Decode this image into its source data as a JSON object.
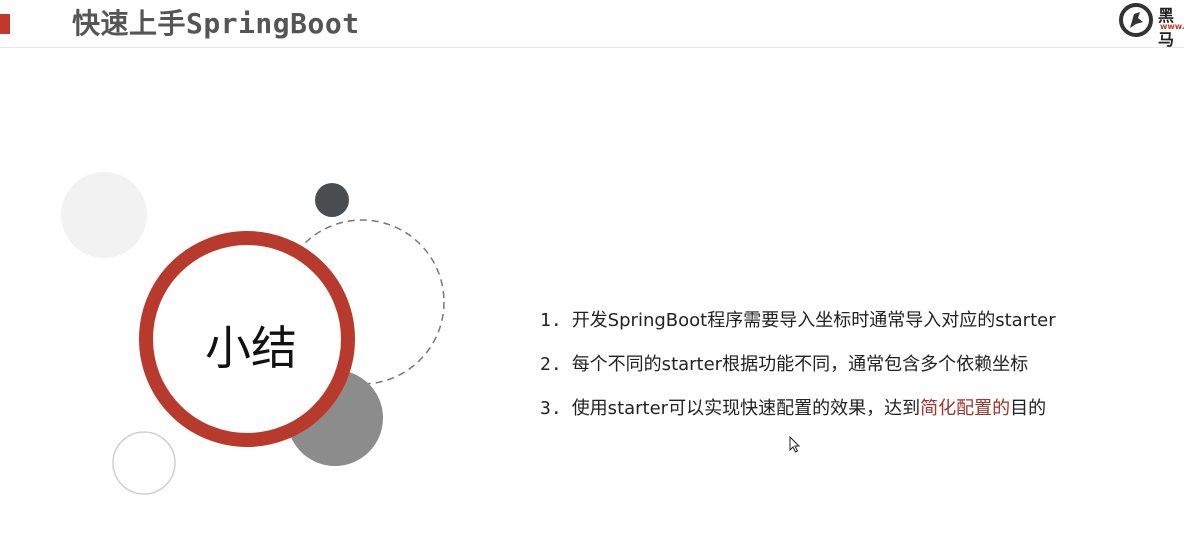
{
  "header": {
    "title": "快速上手SpringBoot",
    "logo_text": "黑马",
    "logo_sub": "www."
  },
  "summary": {
    "title": "小结"
  },
  "points": [
    {
      "num": "1.",
      "text": "开发SpringBoot程序需要导入坐标时通常导入对应的starter"
    },
    {
      "num": "2.",
      "text": "每个不同的starter根据功能不同，通常包含多个依赖坐标"
    },
    {
      "num": "3.",
      "text_before": "使用starter可以实现快速配置的效果，达到",
      "highlight": "简化配置的",
      "text_after": "目的"
    }
  ],
  "colors": {
    "accent": "#c0392b",
    "highlight": "#a3332a"
  }
}
